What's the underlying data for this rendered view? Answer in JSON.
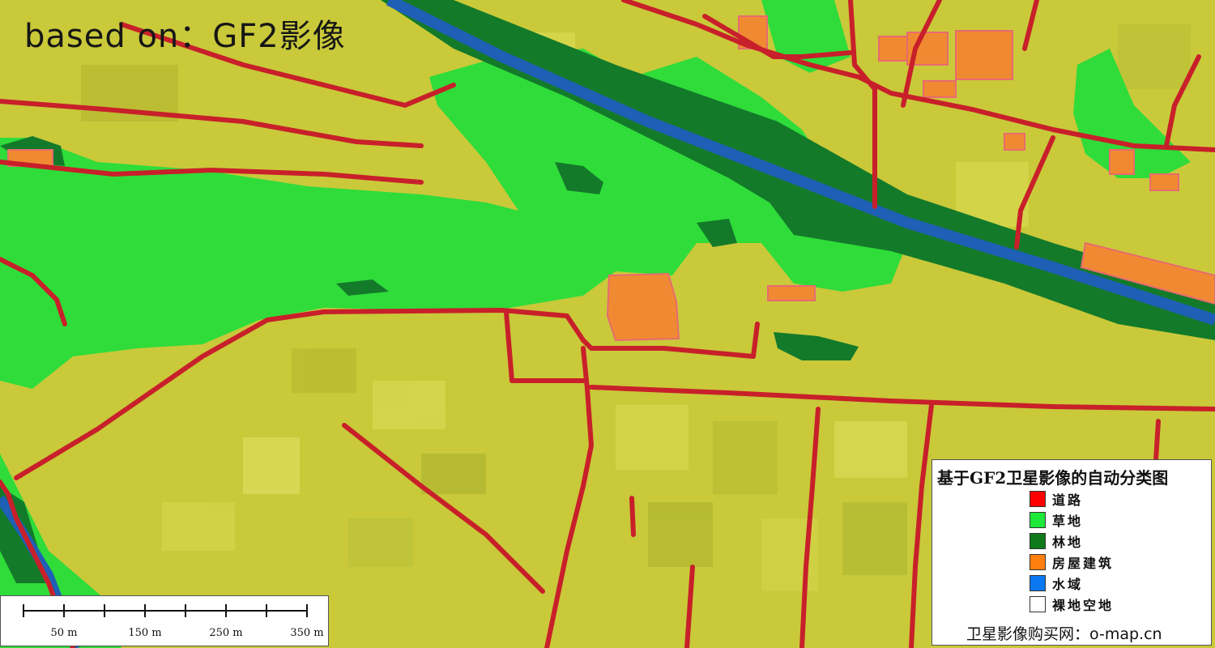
{
  "watermark": {
    "text": "based on：GF2影像"
  },
  "legend": {
    "title": "基于GF2卫星影像的自动分类图",
    "items": [
      {
        "label": "道路",
        "color": "#ff0000"
      },
      {
        "label": "草地",
        "color": "#1ee83a"
      },
      {
        "label": "林地",
        "color": "#0e7a1c"
      },
      {
        "label": "房屋建筑",
        "color": "#ff7f0e"
      },
      {
        "label": "水域",
        "color": "#0a78f0"
      },
      {
        "label": "裸地空地",
        "color": "#ffffff"
      }
    ],
    "footer": "卫星影像购买网：o-map.cn"
  },
  "scalebar": {
    "labels": [
      "50 m",
      "150 m",
      "250 m",
      "350 m"
    ]
  },
  "colors": {
    "farmland": "#c9c93a",
    "grass": "#2fdc3a",
    "forest": "#137a2a",
    "road": "#c8202a",
    "building": "#f08a32",
    "water": "#1f5fb5"
  }
}
